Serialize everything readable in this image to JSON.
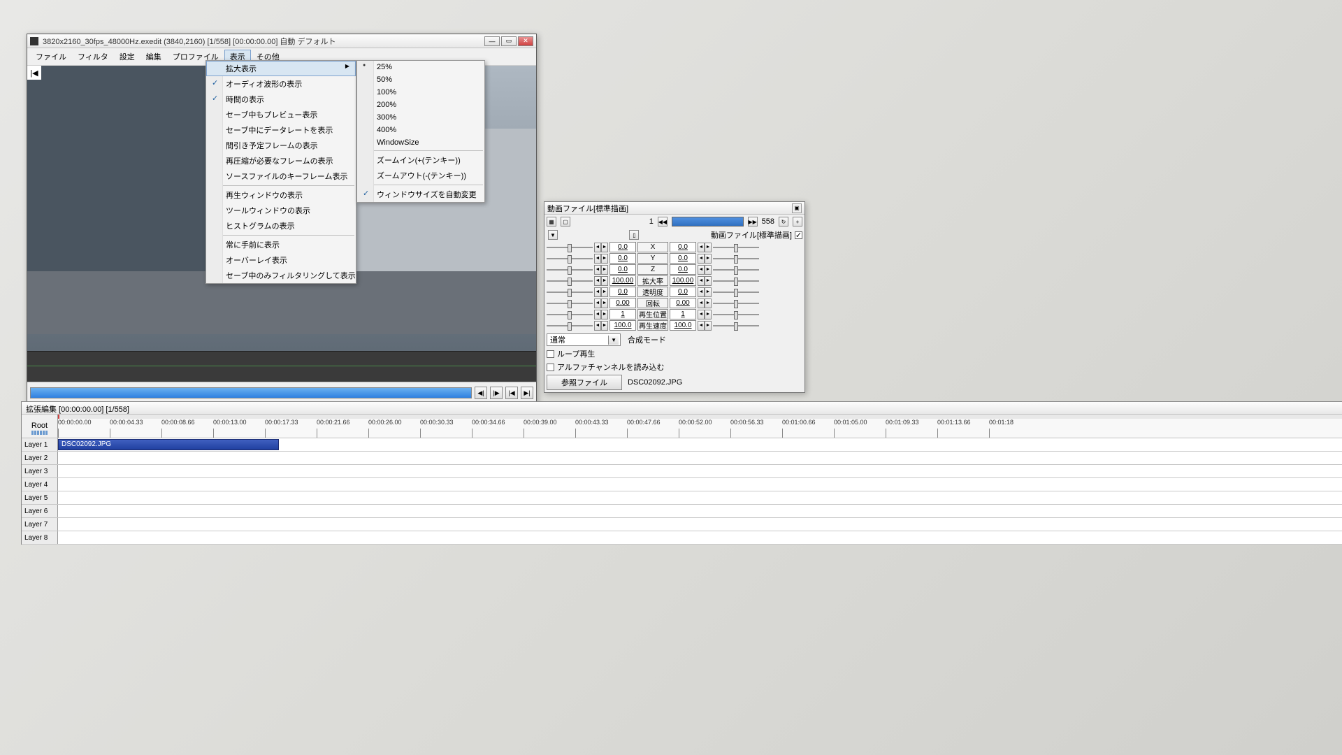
{
  "main": {
    "title": "3820x2160_30fps_48000Hz.exedit (3840,2160) [1/558] [00:00:00.00] 自動 デフォルト",
    "menus": [
      "ファイル",
      "フィルタ",
      "設定",
      "編集",
      "プロファイル",
      "表示",
      "その他"
    ],
    "active_menu_index": 5
  },
  "view_menu": {
    "items": [
      {
        "label": "拡大表示",
        "arrow": true,
        "highlight": true
      },
      {
        "label": "オーディオ波形の表示",
        "checked": true
      },
      {
        "label": "時間の表示",
        "checked": true
      },
      {
        "label": "セーブ中もプレビュー表示"
      },
      {
        "label": "セーブ中にデータレートを表示"
      },
      {
        "label": "間引き予定フレームの表示"
      },
      {
        "label": "再圧縮が必要なフレームの表示"
      },
      {
        "label": "ソースファイルのキーフレーム表示"
      },
      {
        "sep": true
      },
      {
        "label": "再生ウィンドウの表示"
      },
      {
        "label": "ツールウィンドウの表示"
      },
      {
        "label": "ヒストグラムの表示"
      },
      {
        "sep": true
      },
      {
        "label": "常に手前に表示"
      },
      {
        "label": "オーバーレイ表示"
      },
      {
        "label": "セーブ中のみフィルタリングして表示"
      }
    ]
  },
  "zoom_menu": {
    "items": [
      {
        "label": "25%",
        "radio": true
      },
      {
        "label": "50%"
      },
      {
        "label": "100%"
      },
      {
        "label": "200%"
      },
      {
        "label": "300%"
      },
      {
        "label": "400%"
      },
      {
        "label": "WindowSize"
      },
      {
        "sep": true
      },
      {
        "label": "ズームイン(+(テンキー))"
      },
      {
        "label": "ズームアウト(-(テンキー))"
      },
      {
        "sep": true
      },
      {
        "label": "ウィンドウサイズを自動変更",
        "checked": true
      }
    ]
  },
  "prop": {
    "title": "動画ファイル[標準描画]",
    "frame_start": "1",
    "frame_end": "558",
    "sub_label": "動画ファイル[標準描画]",
    "rows": [
      {
        "label": "X",
        "l": "0.0",
        "r": "0.0"
      },
      {
        "label": "Y",
        "l": "0.0",
        "r": "0.0"
      },
      {
        "label": "Z",
        "l": "0.0",
        "r": "0.0"
      },
      {
        "label": "拡大率",
        "l": "100.00",
        "r": "100.00"
      },
      {
        "label": "透明度",
        "l": "0.0",
        "r": "0.0"
      },
      {
        "label": "回転",
        "l": "0.00",
        "r": "0.00"
      },
      {
        "label": "再生位置",
        "l": "1",
        "r": "1"
      },
      {
        "label": "再生速度",
        "l": "100.0",
        "r": "100.0"
      }
    ],
    "blend_label": "合成モード",
    "blend_value": "通常",
    "loop": "ループ再生",
    "alpha": "アルファチャンネルを読み込む",
    "ref_btn": "参照ファイル",
    "ref_file": "DSC02092.JPG"
  },
  "timeline": {
    "title": "拡張編集 [00:00:00.00] [1/558]",
    "root": "Root",
    "ticks": [
      "00:00:00.00",
      "00:00:04.33",
      "00:00:08.66",
      "00:00:13.00",
      "00:00:17.33",
      "00:00:21.66",
      "00:00:26.00",
      "00:00:30.33",
      "00:00:34.66",
      "00:00:39.00",
      "00:00:43.33",
      "00:00:47.66",
      "00:00:52.00",
      "00:00:56.33",
      "00:01:00.66",
      "00:01:05.00",
      "00:01:09.33",
      "00:01:13.66",
      "00:01:18"
    ],
    "layers": [
      "Layer 1",
      "Layer 2",
      "Layer 3",
      "Layer 4",
      "Layer 5",
      "Layer 6",
      "Layer 7",
      "Layer 8"
    ],
    "clip_name": "DSC02092.JPG"
  }
}
